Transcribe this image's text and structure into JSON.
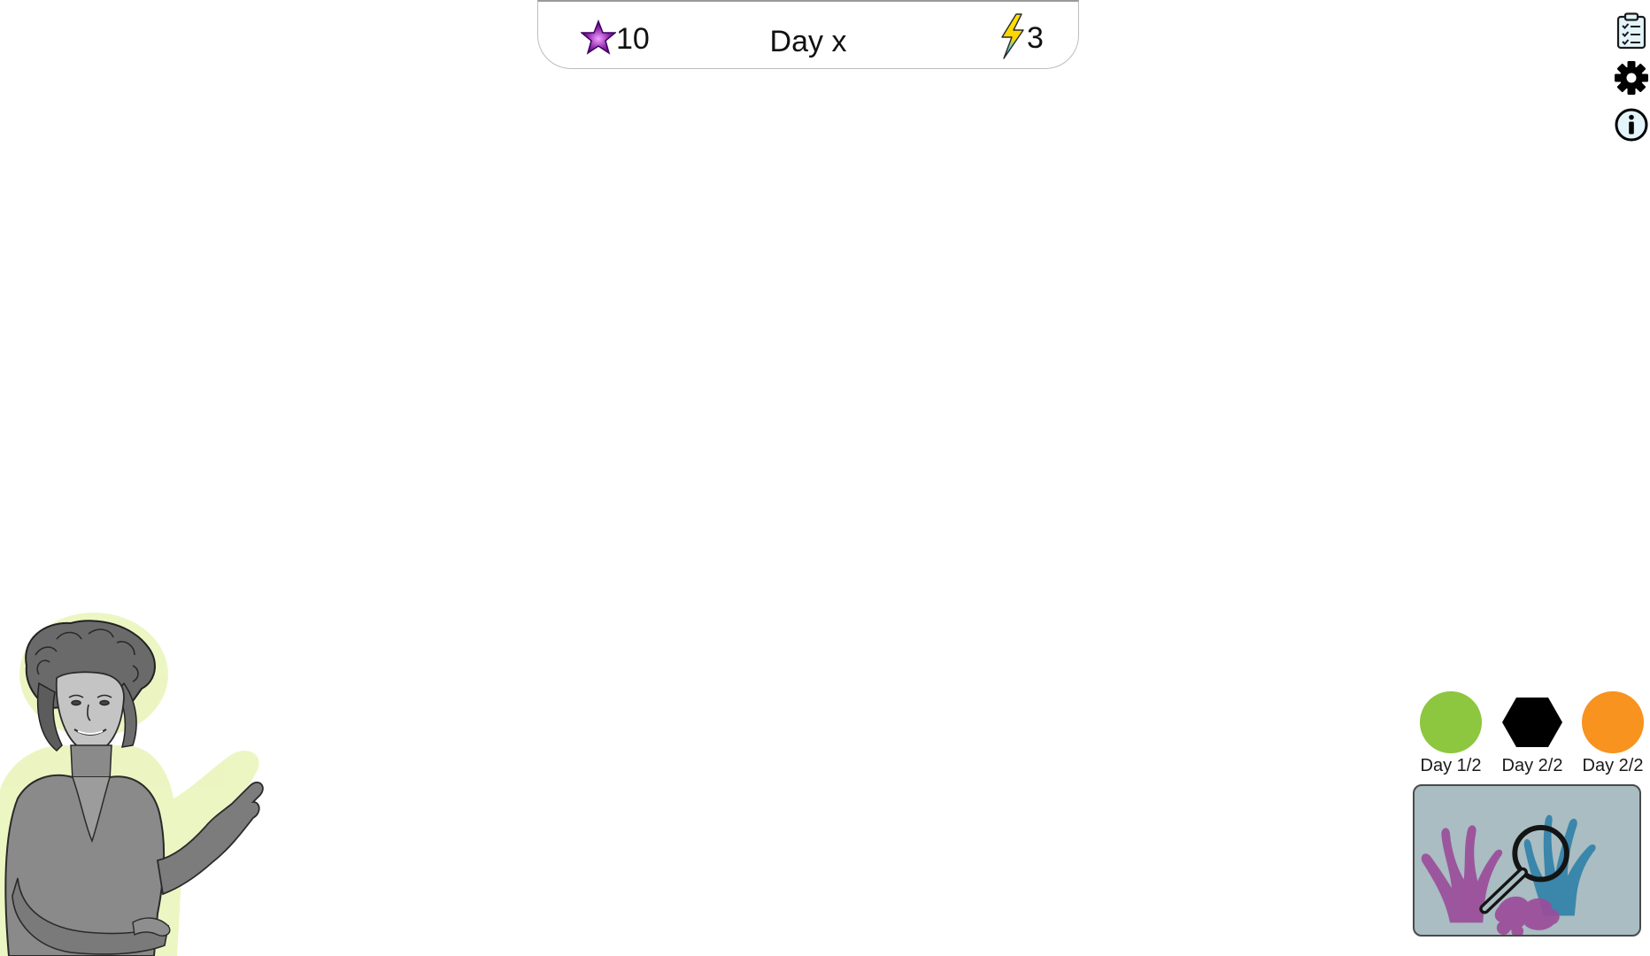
{
  "hud": {
    "stars": "10",
    "day": "Day x",
    "energy": "3"
  },
  "objectives": [
    {
      "shape": "circle",
      "color": "#8dc63f",
      "label": "Day 1/2"
    },
    {
      "shape": "hexagon",
      "color": "#000000",
      "label": "Day 2/2"
    },
    {
      "shape": "circle",
      "color": "#f7931e",
      "label": "Day 2/2"
    }
  ],
  "icons": {
    "star": "star-icon",
    "energy": "lightning-icon",
    "tasks": "clipboard-checklist-icon",
    "settings": "gear-icon",
    "info": "info-icon",
    "inspect": "magnifier-icon"
  },
  "colors": {
    "star": "#7b1fa2",
    "inspect_panel": "#a9bdc2",
    "character_glow": "#e9f4b8"
  }
}
